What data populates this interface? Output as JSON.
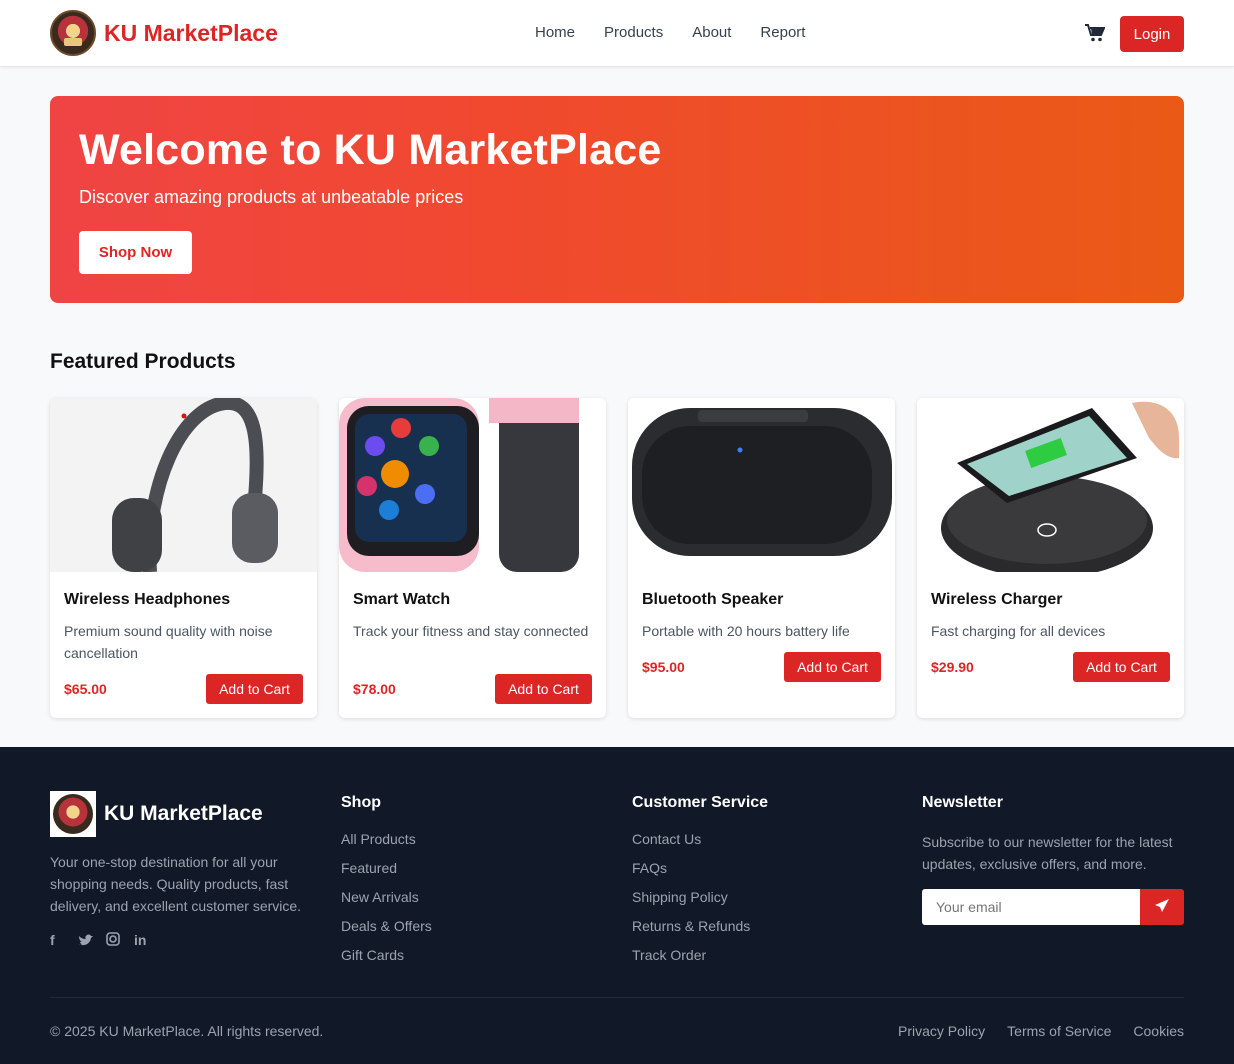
{
  "header": {
    "brand": "KU MarketPlace",
    "nav": [
      "Home",
      "Products",
      "About",
      "Report"
    ],
    "login_label": "Login",
    "accent_color": "#dc2626"
  },
  "hero": {
    "title": "Welcome to KU MarketPlace",
    "subtitle": "Discover amazing products at unbeatable prices",
    "button": "Shop Now"
  },
  "featured": {
    "title": "Featured Products",
    "products": [
      {
        "name": "Wireless Headphones",
        "description": "Premium sound quality with noise cancellation",
        "price": "$65.00",
        "button": "Add to Cart",
        "image": "headphones"
      },
      {
        "name": "Smart Watch",
        "description": "Track your fitness and stay connected",
        "price": "$78.00",
        "button": "Add to Cart",
        "image": "smartwatch"
      },
      {
        "name": "Bluetooth Speaker",
        "description": "Portable with 20 hours battery life",
        "price": "$95.00",
        "button": "Add to Cart",
        "image": "speaker"
      },
      {
        "name": "Wireless Charger",
        "description": "Fast charging for all devices",
        "price": "$29.90",
        "button": "Add to Cart",
        "image": "charger"
      }
    ]
  },
  "footer": {
    "brand": "KU MarketPlace",
    "about": "Your one-stop destination for all your shopping needs. Quality products, fast delivery, and excellent customer service.",
    "social": [
      "facebook-icon",
      "twitter-icon",
      "instagram-icon",
      "linkedin-icon"
    ],
    "shop": {
      "title": "Shop",
      "links": [
        "All Products",
        "Featured",
        "New Arrivals",
        "Deals & Offers",
        "Gift Cards"
      ]
    },
    "service": {
      "title": "Customer Service",
      "links": [
        "Contact Us",
        "FAQs",
        "Shipping Policy",
        "Returns & Refunds",
        "Track Order"
      ]
    },
    "newsletter": {
      "title": "Newsletter",
      "text": "Subscribe to our newsletter for the latest updates, exclusive offers, and more.",
      "placeholder": "Your email"
    },
    "copyright": "© 2025 KU MarketPlace. All rights reserved.",
    "legal": [
      "Privacy Policy",
      "Terms of Service",
      "Cookies"
    ]
  }
}
